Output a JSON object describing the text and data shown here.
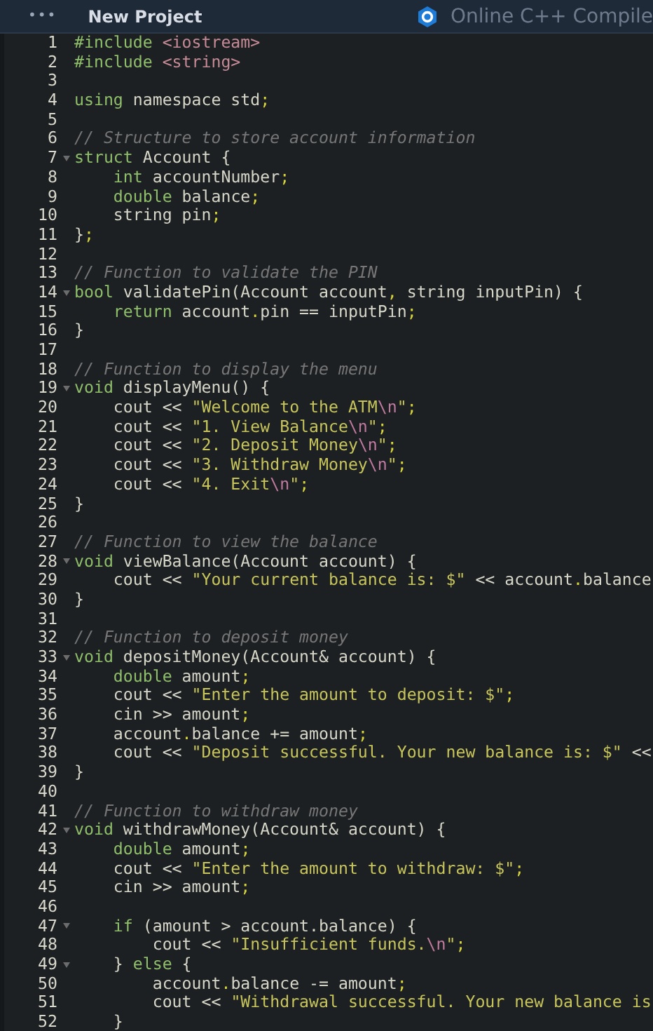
{
  "header": {
    "menu_icon": "•••",
    "project": "New Project",
    "site": "Online C++ Compile"
  },
  "lines": [
    {
      "number": "1",
      "fold": false,
      "tokens": [
        {
          "kind": "kw",
          "text": "#include"
        },
        {
          "kind": "header",
          "text": " <iostream>"
        }
      ]
    },
    {
      "number": "2",
      "fold": false,
      "tokens": [
        {
          "kind": "kw",
          "text": "#include"
        },
        {
          "kind": "header",
          "text": " <string>"
        }
      ]
    },
    {
      "number": "3",
      "fold": false
    },
    {
      "number": "4",
      "fold": false,
      "tokens": [
        {
          "kind": "kw",
          "text": "using"
        },
        {
          "kind": "plain",
          "text": " namespace std"
        },
        {
          "kind": "punct",
          "text": ";"
        }
      ]
    },
    {
      "number": "5",
      "fold": false
    },
    {
      "number": "6",
      "fold": false,
      "tokens": [
        {
          "kind": "comment",
          "text": "// Structure to store account information"
        }
      ]
    },
    {
      "number": "7",
      "fold": true,
      "tokens": [
        {
          "kind": "kw",
          "text": "struct"
        },
        {
          "kind": "plain",
          "text": " Account {"
        }
      ]
    },
    {
      "number": "8",
      "fold": false,
      "tokens": [
        {
          "kind": "kw",
          "text": "    int"
        },
        {
          "kind": "plain",
          "text": " accountNumber"
        },
        {
          "kind": "punct",
          "text": ";"
        }
      ]
    },
    {
      "number": "9",
      "fold": false,
      "tokens": [
        {
          "kind": "kw",
          "text": "    double"
        },
        {
          "kind": "plain",
          "text": " balance"
        },
        {
          "kind": "punct",
          "text": ";"
        }
      ]
    },
    {
      "number": "10",
      "fold": false,
      "tokens": [
        {
          "kind": "plain",
          "text": "    string pin"
        },
        {
          "kind": "punct",
          "text": ";"
        }
      ]
    },
    {
      "number": "11",
      "fold": false,
      "tokens": [
        {
          "kind": "plain",
          "text": "}"
        },
        {
          "kind": "punct",
          "text": ";"
        }
      ]
    },
    {
      "number": "12",
      "fold": false
    },
    {
      "number": "13",
      "fold": false,
      "tokens": [
        {
          "kind": "comment",
          "text": "// Function to validate the PIN"
        }
      ]
    },
    {
      "number": "14",
      "fold": true,
      "tokens": [
        {
          "kind": "kw",
          "text": "bool"
        },
        {
          "kind": "plain",
          "text": " validatePin(Account account"
        },
        {
          "kind": "punct",
          "text": ","
        },
        {
          "kind": "plain",
          "text": " string inputPin) {"
        }
      ]
    },
    {
      "number": "15",
      "fold": false,
      "tokens": [
        {
          "kind": "kw",
          "text": "    return"
        },
        {
          "kind": "plain",
          "text": " account"
        },
        {
          "kind": "punct",
          "text": "."
        },
        {
          "kind": "plain",
          "text": "pin == inputPin"
        },
        {
          "kind": "punct",
          "text": ";"
        }
      ]
    },
    {
      "number": "16",
      "fold": false,
      "tokens": [
        {
          "kind": "plain",
          "text": "}"
        }
      ]
    },
    {
      "number": "17",
      "fold": false
    },
    {
      "number": "18",
      "fold": false,
      "tokens": [
        {
          "kind": "comment",
          "text": "// Function to display the menu"
        }
      ]
    },
    {
      "number": "19",
      "fold": true,
      "tokens": [
        {
          "kind": "kw",
          "text": "void"
        },
        {
          "kind": "plain",
          "text": " displayMenu() {"
        }
      ]
    },
    {
      "number": "20",
      "fold": false,
      "tokens": [
        {
          "kind": "plain",
          "text": "    cout << "
        },
        {
          "kind": "str",
          "text": "\"Welcome to the ATM"
        },
        {
          "kind": "esc",
          "text": "\\n"
        },
        {
          "kind": "str",
          "text": "\""
        },
        {
          "kind": "punct",
          "text": ";"
        }
      ]
    },
    {
      "number": "21",
      "fold": false,
      "tokens": [
        {
          "kind": "plain",
          "text": "    cout << "
        },
        {
          "kind": "str",
          "text": "\"1. View Balance"
        },
        {
          "kind": "esc",
          "text": "\\n"
        },
        {
          "kind": "str",
          "text": "\""
        },
        {
          "kind": "punct",
          "text": ";"
        }
      ]
    },
    {
      "number": "22",
      "fold": false,
      "tokens": [
        {
          "kind": "plain",
          "text": "    cout << "
        },
        {
          "kind": "str",
          "text": "\"2. Deposit Money"
        },
        {
          "kind": "esc",
          "text": "\\n"
        },
        {
          "kind": "str",
          "text": "\""
        },
        {
          "kind": "punct",
          "text": ";"
        }
      ]
    },
    {
      "number": "23",
      "fold": false,
      "tokens": [
        {
          "kind": "plain",
          "text": "    cout << "
        },
        {
          "kind": "str",
          "text": "\"3. Withdraw Money"
        },
        {
          "kind": "esc",
          "text": "\\n"
        },
        {
          "kind": "str",
          "text": "\""
        },
        {
          "kind": "punct",
          "text": ";"
        }
      ]
    },
    {
      "number": "24",
      "fold": false,
      "tokens": [
        {
          "kind": "plain",
          "text": "    cout << "
        },
        {
          "kind": "str",
          "text": "\"4. Exit"
        },
        {
          "kind": "esc",
          "text": "\\n"
        },
        {
          "kind": "str",
          "text": "\""
        },
        {
          "kind": "punct",
          "text": ";"
        }
      ]
    },
    {
      "number": "25",
      "fold": false,
      "tokens": [
        {
          "kind": "plain",
          "text": "}"
        }
      ]
    },
    {
      "number": "26",
      "fold": false
    },
    {
      "number": "27",
      "fold": false,
      "tokens": [
        {
          "kind": "comment",
          "text": "// Function to view the balance"
        }
      ]
    },
    {
      "number": "28",
      "fold": true,
      "tokens": [
        {
          "kind": "kw",
          "text": "void"
        },
        {
          "kind": "plain",
          "text": " viewBalance(Account account) {"
        }
      ]
    },
    {
      "number": "29",
      "fold": false,
      "tokens": [
        {
          "kind": "plain",
          "text": "    cout << "
        },
        {
          "kind": "str",
          "text": "\"Your current balance is: $\""
        },
        {
          "kind": "plain",
          "text": " << account"
        },
        {
          "kind": "punct",
          "text": "."
        },
        {
          "kind": "plain",
          "text": "balance"
        }
      ]
    },
    {
      "number": "30",
      "fold": false,
      "tokens": [
        {
          "kind": "plain",
          "text": "}"
        }
      ]
    },
    {
      "number": "31",
      "fold": false
    },
    {
      "number": "32",
      "fold": false,
      "tokens": [
        {
          "kind": "comment",
          "text": "// Function to deposit money"
        }
      ]
    },
    {
      "number": "33",
      "fold": true,
      "tokens": [
        {
          "kind": "kw",
          "text": "void"
        },
        {
          "kind": "plain",
          "text": " depositMoney(Account& account) {"
        }
      ]
    },
    {
      "number": "34",
      "fold": false,
      "tokens": [
        {
          "kind": "kw",
          "text": "    double"
        },
        {
          "kind": "plain",
          "text": " amount"
        },
        {
          "kind": "punct",
          "text": ";"
        }
      ]
    },
    {
      "number": "35",
      "fold": false,
      "tokens": [
        {
          "kind": "plain",
          "text": "    cout << "
        },
        {
          "kind": "str",
          "text": "\"Enter the amount to deposit: $\""
        },
        {
          "kind": "punct",
          "text": ";"
        }
      ]
    },
    {
      "number": "36",
      "fold": false,
      "tokens": [
        {
          "kind": "plain",
          "text": "    cin >> amount"
        },
        {
          "kind": "punct",
          "text": ";"
        }
      ]
    },
    {
      "number": "37",
      "fold": false,
      "tokens": [
        {
          "kind": "plain",
          "text": "    account"
        },
        {
          "kind": "punct",
          "text": "."
        },
        {
          "kind": "plain",
          "text": "balance += amount"
        },
        {
          "kind": "punct",
          "text": ";"
        }
      ]
    },
    {
      "number": "38",
      "fold": false,
      "tokens": [
        {
          "kind": "plain",
          "text": "    cout << "
        },
        {
          "kind": "str",
          "text": "\"Deposit successful. Your new balance is: $\""
        },
        {
          "kind": "plain",
          "text": " <<"
        }
      ]
    },
    {
      "number": "39",
      "fold": false,
      "tokens": [
        {
          "kind": "plain",
          "text": "}"
        }
      ]
    },
    {
      "number": "40",
      "fold": false
    },
    {
      "number": "41",
      "fold": false,
      "tokens": [
        {
          "kind": "comment",
          "text": "// Function to withdraw money"
        }
      ]
    },
    {
      "number": "42",
      "fold": true,
      "tokens": [
        {
          "kind": "kw",
          "text": "void"
        },
        {
          "kind": "plain",
          "text": " withdrawMoney(Account& account) {"
        }
      ]
    },
    {
      "number": "43",
      "fold": false,
      "tokens": [
        {
          "kind": "kw",
          "text": "    double"
        },
        {
          "kind": "plain",
          "text": " amount"
        },
        {
          "kind": "punct",
          "text": ";"
        }
      ]
    },
    {
      "number": "44",
      "fold": false,
      "tokens": [
        {
          "kind": "plain",
          "text": "    cout << "
        },
        {
          "kind": "str",
          "text": "\"Enter the amount to withdraw: $\""
        },
        {
          "kind": "punct",
          "text": ";"
        }
      ]
    },
    {
      "number": "45",
      "fold": false,
      "tokens": [
        {
          "kind": "plain",
          "text": "    cin >> amount"
        },
        {
          "kind": "punct",
          "text": ";"
        }
      ]
    },
    {
      "number": "46",
      "fold": false
    },
    {
      "number": "47",
      "fold": true,
      "tokens": [
        {
          "kind": "kw",
          "text": "    if"
        },
        {
          "kind": "plain",
          "text": " (amount > account.balance) {"
        }
      ]
    },
    {
      "number": "48",
      "fold": false,
      "tokens": [
        {
          "kind": "plain",
          "text": "        cout << "
        },
        {
          "kind": "str",
          "text": "\"Insufficient funds."
        },
        {
          "kind": "esc",
          "text": "\\n"
        },
        {
          "kind": "str",
          "text": "\""
        },
        {
          "kind": "punct",
          "text": ";"
        }
      ]
    },
    {
      "number": "49",
      "fold": true,
      "tokens": [
        {
          "kind": "plain",
          "text": "    } "
        },
        {
          "kind": "kw",
          "text": "else"
        },
        {
          "kind": "plain",
          "text": " {"
        }
      ]
    },
    {
      "number": "50",
      "fold": false,
      "tokens": [
        {
          "kind": "plain",
          "text": "        account"
        },
        {
          "kind": "punct",
          "text": "."
        },
        {
          "kind": "plain",
          "text": "balance -= amount"
        },
        {
          "kind": "punct",
          "text": ";"
        }
      ]
    },
    {
      "number": "51",
      "fold": false,
      "tokens": [
        {
          "kind": "plain",
          "text": "        cout << "
        },
        {
          "kind": "str",
          "text": "\"Withdrawal successful. Your new balance is"
        }
      ]
    },
    {
      "number": "52",
      "fold": false,
      "tokens": [
        {
          "kind": "plain",
          "text": "    }"
        }
      ]
    }
  ]
}
